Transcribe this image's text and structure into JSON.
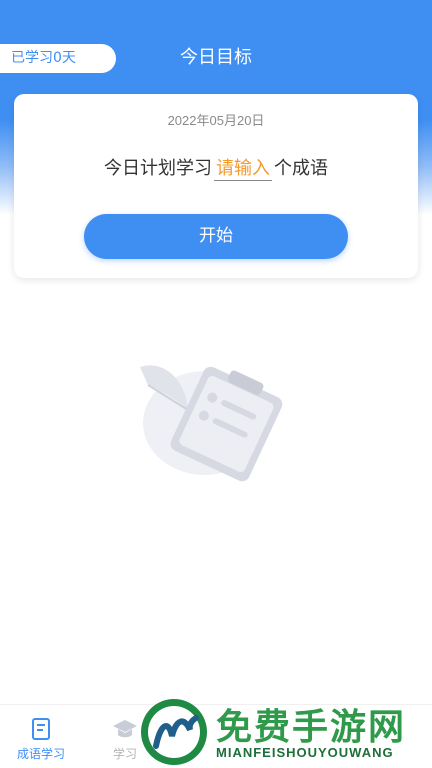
{
  "header": {
    "days_badge": "已学习0天",
    "title": "今日目标"
  },
  "card": {
    "date": "2022年05月20日",
    "plan_prefix": "今日计划学习",
    "plan_input_placeholder": "请输入",
    "plan_suffix": "个成语",
    "start_label": "开始"
  },
  "empty_state": {
    "icon": "clipboard-quill-icon"
  },
  "tabbar": {
    "tabs": [
      {
        "label": "成语学习",
        "icon": "book-icon",
        "active": true
      },
      {
        "label": "学习",
        "icon": "graduation-cap-icon",
        "active": false
      }
    ]
  },
  "watermark": {
    "text_cn": "免费手游网",
    "text_en": "MIANFEISHOUYOUWANG"
  },
  "colors": {
    "primary": "#3f8ff3",
    "accent": "#f39a2b",
    "watermark_green": "#2e9a4a"
  }
}
